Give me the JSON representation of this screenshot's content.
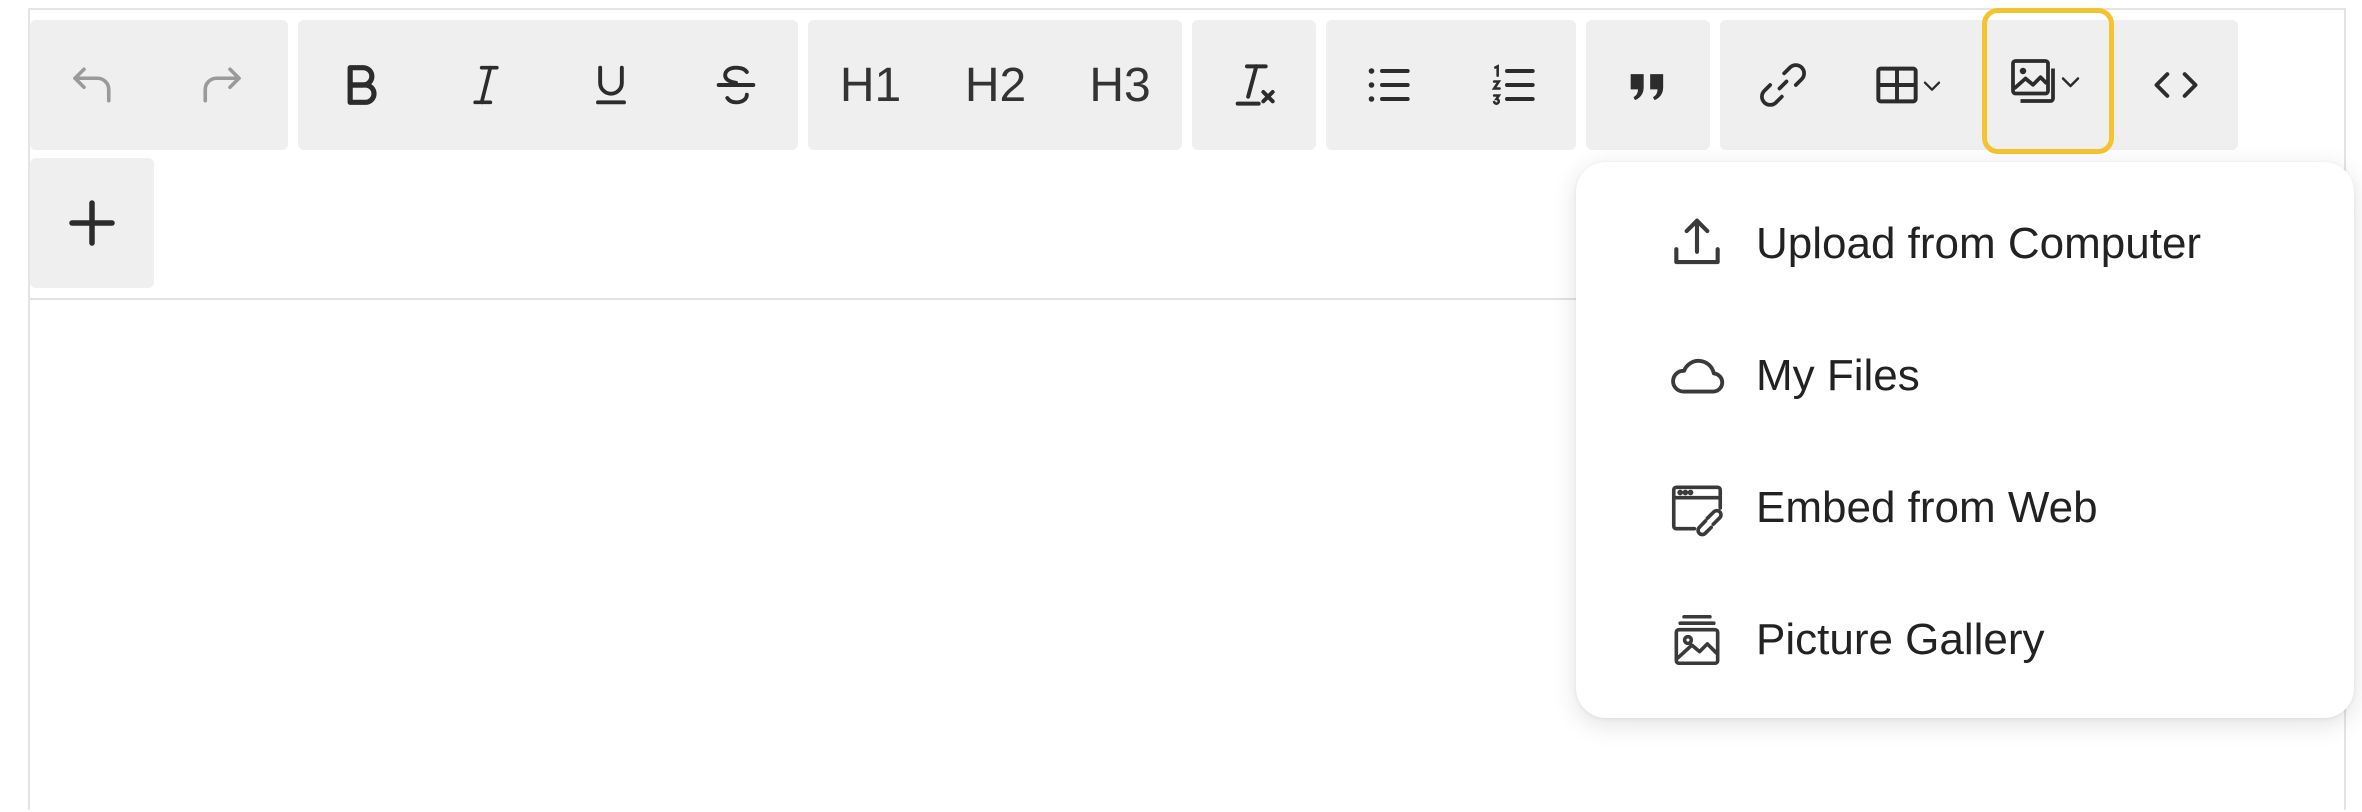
{
  "toolbar": {
    "undo_icon": "undo-icon",
    "redo_icon": "redo-icon",
    "bold_icon": "bold-icon",
    "italic_icon": "italic-icon",
    "underline_icon": "underline-icon",
    "strikethrough_icon": "strikethrough-icon",
    "h1_label": "H1",
    "h2_label": "H2",
    "h3_label": "H3",
    "clear_format_icon": "clear-formatting-icon",
    "bullet_list_icon": "bullet-list-icon",
    "numbered_list_icon": "numbered-list-icon",
    "quote_icon": "quote-icon",
    "link_icon": "link-icon",
    "table_icon": "table-icon",
    "image_icon": "image-icon",
    "code_icon": "code-icon",
    "add_icon": "plus-icon",
    "highlight_color": "#f4c430"
  },
  "image_menu": {
    "items": [
      {
        "label": "Upload from Computer",
        "icon": "upload-icon"
      },
      {
        "label": "My Files",
        "icon": "cloud-icon"
      },
      {
        "label": "Embed from Web",
        "icon": "embed-web-icon"
      },
      {
        "label": "Picture Gallery",
        "icon": "picture-gallery-icon"
      }
    ]
  }
}
